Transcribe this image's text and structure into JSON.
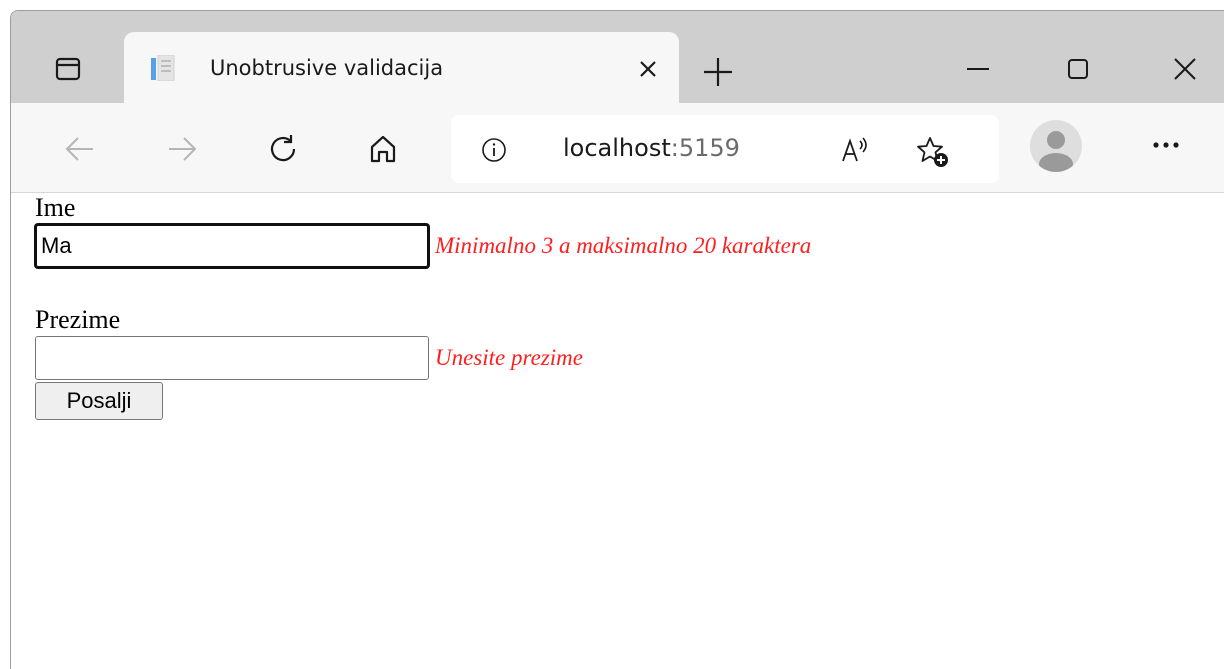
{
  "browser": {
    "tab": {
      "title": "Unobtrusive validacija"
    },
    "address_bar": {
      "host": "localhost",
      "port": ":5159"
    }
  },
  "icons": {
    "tab_actions": "tab-actions-icon",
    "favicon": "document-icon",
    "close": "close-icon",
    "new_tab": "plus-icon",
    "minimize": "minimize-icon",
    "maximize": "maximize-icon",
    "window_close": "close-icon",
    "back": "arrow-left-icon",
    "forward": "arrow-right-icon",
    "refresh": "refresh-icon",
    "home": "home-icon",
    "info": "info-icon",
    "read_aloud": "read-aloud-icon",
    "favorites": "add-favorite-icon",
    "profile": "avatar-icon",
    "more": "more-icon"
  },
  "form": {
    "first_name": {
      "label": "Ime",
      "value": "Ma",
      "error": "Minimalno 3 a maksimalno 20 karaktera"
    },
    "last_name": {
      "label": "Prezime",
      "value": "",
      "error": "Unesite prezime"
    },
    "submit_label": "Posalji"
  },
  "colors": {
    "error": "#ff1e1e",
    "tabbar": "#cfcfcf",
    "toolbar": "#f7f7f7"
  }
}
